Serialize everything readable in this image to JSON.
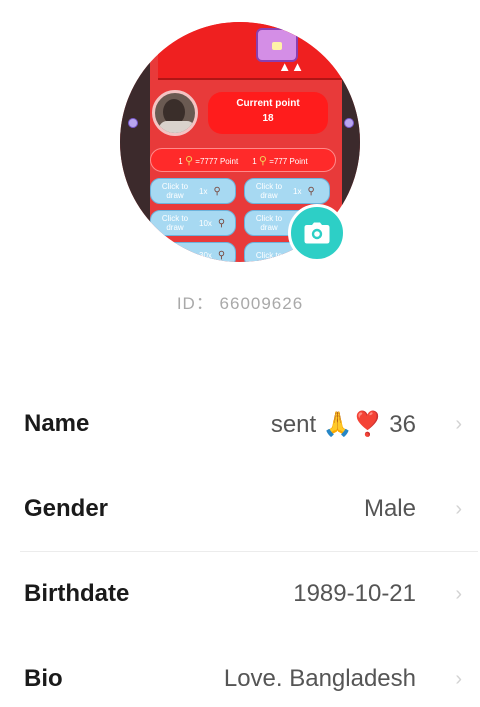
{
  "avatar": {
    "current_point_label": "Current point",
    "current_point_value": "18",
    "price_1": "1",
    "price_1_text": "=7777 Point",
    "price_2": "1",
    "price_2_text": "=777 Point",
    "draw_buttons": [
      {
        "label": "Click to draw",
        "multiplier": "1x"
      },
      {
        "label": "Click to draw",
        "multiplier": "1x"
      },
      {
        "label": "Click to draw",
        "multiplier": "10x"
      },
      {
        "label": "Click to draw",
        "multiplier": ""
      },
      {
        "label": "",
        "multiplier": "30x"
      },
      {
        "label": "Click to",
        "multiplier": ""
      }
    ]
  },
  "camera": {
    "icon": "camera-icon",
    "color": "#2dcfc6"
  },
  "profile": {
    "id_text": "ID： 66009626",
    "rows": [
      {
        "label": "Name",
        "value": "sent 🙏❣️ 36"
      },
      {
        "label": "Gender",
        "value": "Male"
      },
      {
        "label": "Birthdate",
        "value": "1989-10-21"
      },
      {
        "label": "Bio",
        "value": "Love. Bangladesh"
      }
    ],
    "chevron": "›"
  }
}
